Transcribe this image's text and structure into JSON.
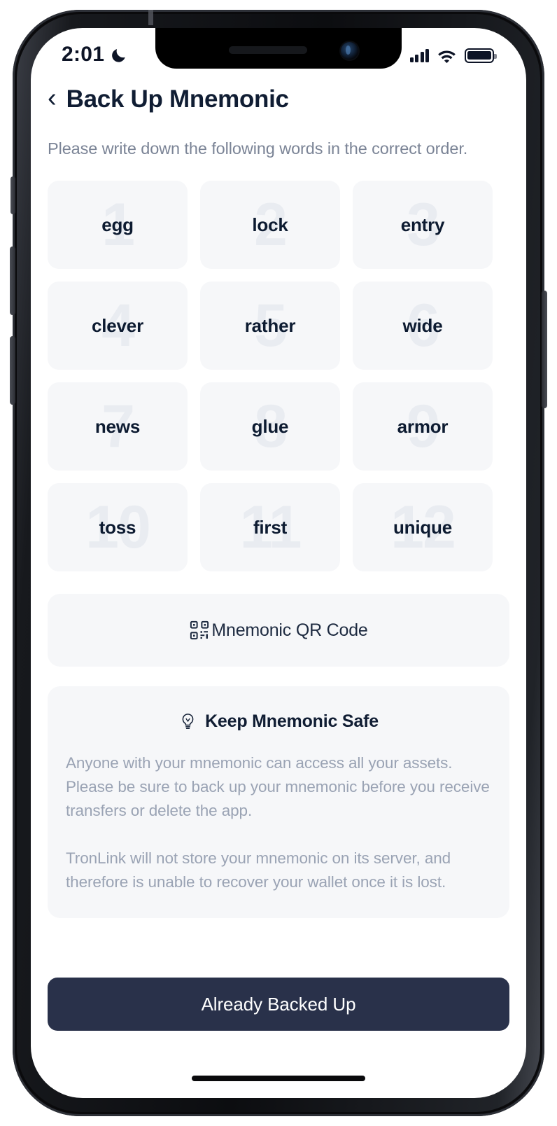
{
  "status_bar": {
    "time": "2:01",
    "moon_icon": "crescent-moon-icon",
    "signal_icon": "cellular-bars-icon",
    "wifi_icon": "wifi-icon",
    "battery_icon": "battery-full-icon"
  },
  "nav": {
    "back_icon": "chevron-left-icon",
    "title": "Back Up Mnemonic"
  },
  "subtitle": "Please write down the following words in the correct order.",
  "mnemonic": {
    "words": [
      {
        "index": "1",
        "word": "egg"
      },
      {
        "index": "2",
        "word": "lock"
      },
      {
        "index": "3",
        "word": "entry"
      },
      {
        "index": "4",
        "word": "clever"
      },
      {
        "index": "5",
        "word": "rather"
      },
      {
        "index": "6",
        "word": "wide"
      },
      {
        "index": "7",
        "word": "news"
      },
      {
        "index": "8",
        "word": "glue"
      },
      {
        "index": "9",
        "word": "armor"
      },
      {
        "index": "10",
        "word": "toss"
      },
      {
        "index": "11",
        "word": "first"
      },
      {
        "index": "12",
        "word": "unique"
      }
    ]
  },
  "qr_row": {
    "icon": "qr-code-icon",
    "label": "Mnemonic QR Code"
  },
  "info_card": {
    "icon": "lightbulb-icon",
    "title": "Keep Mnemonic Safe",
    "paragraph_1": "Anyone with your mnemonic can access all your assets. Please be sure to back up your mnemonic before you receive transfers or delete the app.",
    "paragraph_2": "TronLink will not store your mnemonic on its server, and therefore is unable to recover your wallet once it is lost."
  },
  "cta": {
    "label": "Already Backed Up"
  },
  "colors": {
    "accent_dark": "#29314a",
    "text_primary": "#101d33",
    "text_muted": "#7b8496",
    "text_body": "#9aa3b4",
    "card_bg": "#f6f7f9",
    "number_ghost": "#e9ecf1",
    "screen_bg": "#ffffff"
  }
}
